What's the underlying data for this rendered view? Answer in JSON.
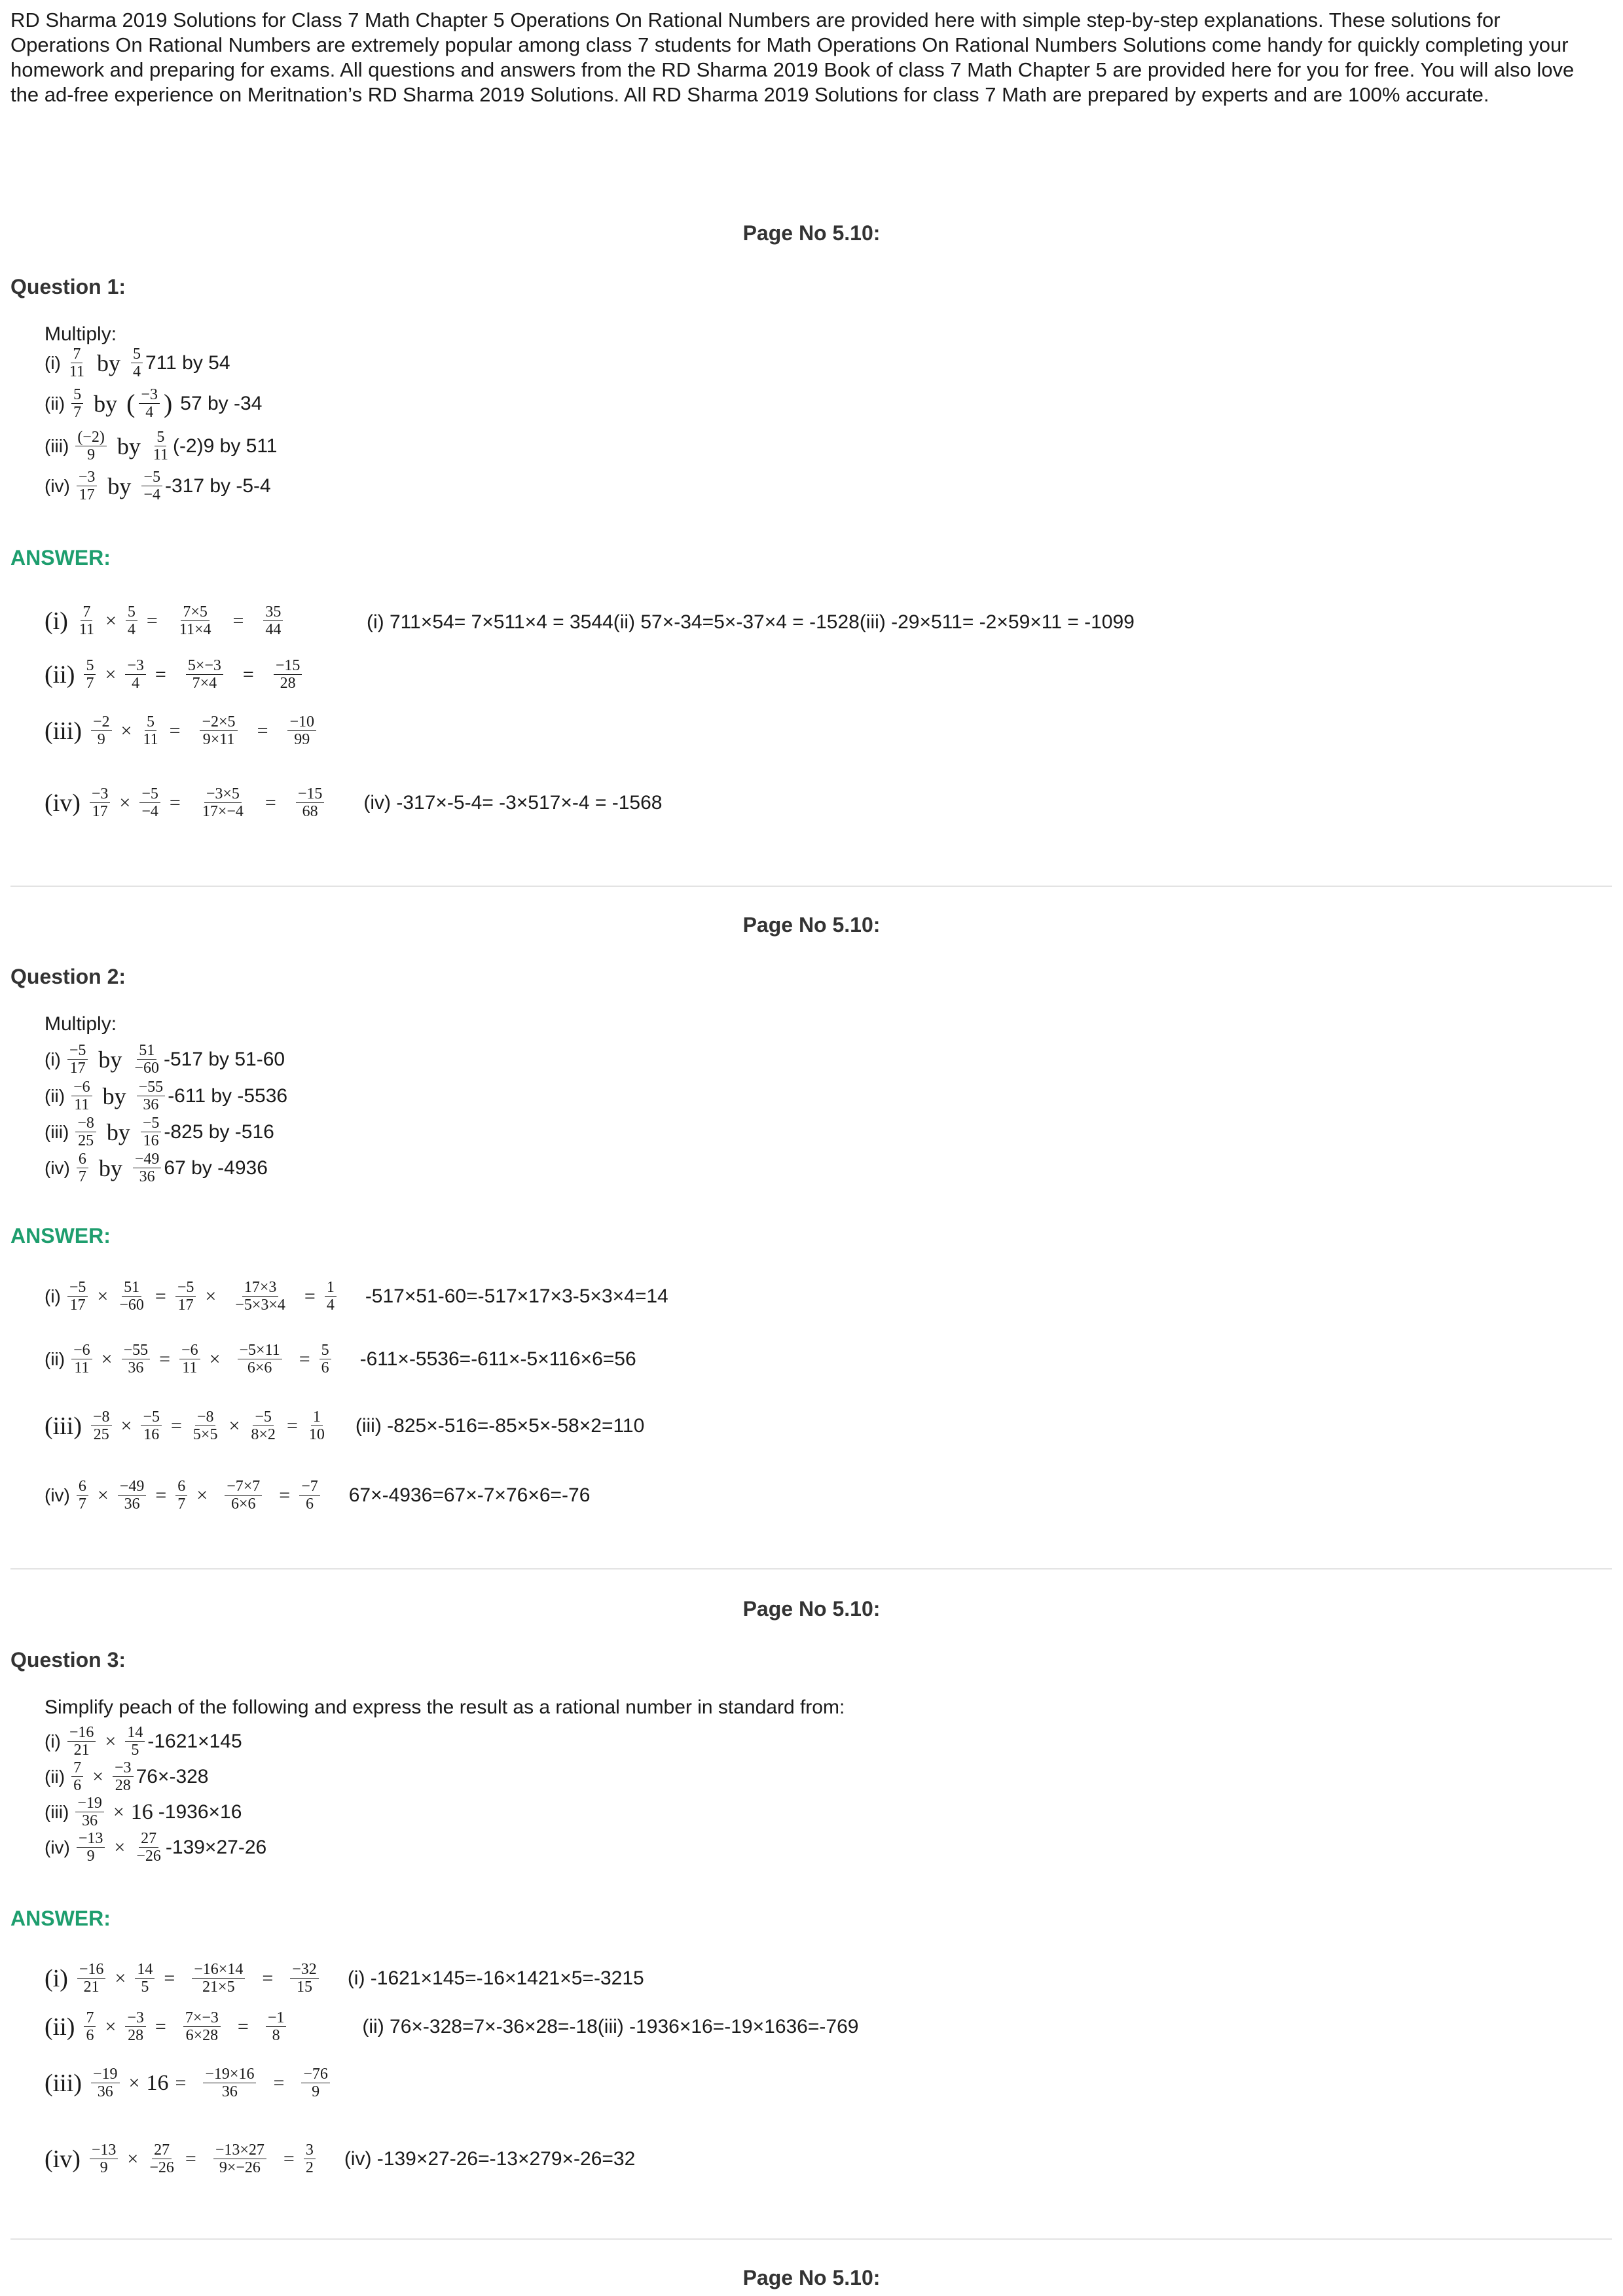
{
  "intro": "RD Sharma 2019 Solutions for Class 7 Math Chapter 5 Operations On Rational Numbers are provided here with simple step-by-step explanations. These solutions for Operations On Rational Numbers are extremely popular among class 7 students for Math Operations On Rational Numbers Solutions come handy for quickly completing your homework and preparing for exams. All questions and answers from the RD Sharma 2019 Book of class 7 Math Chapter 5 are provided here for you for free. You will also love the ad-free experience on Meritnation’s RD Sharma 2019 Solutions. All RD Sharma 2019 Solutions for class 7 Math are prepared by experts and are 100% accurate.",
  "page_no": "Page No 5.10:",
  "answer_label": "ANSWER:",
  "words": {
    "by": "by",
    "times": "×",
    "eq": "=",
    "lp": "(",
    "rp": ")"
  },
  "tags": {
    "i": "(i)",
    "ii": "(ii)",
    "iii": "(iii)",
    "iv": "(iv)"
  },
  "q1": {
    "title": "Question 1:",
    "intro": "Multiply:",
    "items": [
      {
        "a": [
          "7",
          "11"
        ],
        "b": [
          "5",
          "4"
        ],
        "plain": "711 by 54"
      },
      {
        "a": [
          "5",
          "7"
        ],
        "b": [
          "−3",
          "4"
        ],
        "plain": "57 by -34"
      },
      {
        "a": [
          "(−2)",
          "9"
        ],
        "b": [
          "5",
          "11"
        ],
        "plain": "(-2)9 by 511"
      },
      {
        "a": [
          "−3",
          "17"
        ],
        "b": [
          "−5",
          "−4"
        ],
        "plain": "-317 by -5-4"
      }
    ],
    "answer": {
      "rows": [
        {
          "a": [
            "7",
            "11"
          ],
          "b": [
            "5",
            "4"
          ],
          "c": [
            "7×5",
            "11×4"
          ],
          "r": [
            "35",
            "44"
          ]
        },
        {
          "a": [
            "5",
            "7"
          ],
          "b": [
            "−3",
            "4"
          ],
          "c": [
            "5×−3",
            "7×4"
          ],
          "r": [
            "−15",
            "28"
          ]
        },
        {
          "a": [
            "−2",
            "9"
          ],
          "b": [
            "5",
            "11"
          ],
          "c": [
            "−2×5",
            "9×11"
          ],
          "r": [
            "−10",
            "99"
          ]
        },
        {
          "a": [
            "−3",
            "17"
          ],
          "b": [
            "−5",
            "−4"
          ],
          "c": [
            "−3×5",
            "17×−4"
          ],
          "r": [
            "−15",
            "68"
          ]
        }
      ],
      "plain1": "(i) 711×54= 7×511×4 = 3544(ii) 57×-34=5×-37×4 = -1528(iii) -29×511= -2×59×11 = -1099",
      "plain2": "(iv) -317×-5-4= -3×517×-4 = -1568"
    }
  },
  "q2": {
    "title": "Question 2:",
    "intro": "Multiply:",
    "items": [
      {
        "a": [
          "−5",
          "17"
        ],
        "b": [
          "51",
          "−60"
        ],
        "plain": "-517 by 51-60"
      },
      {
        "a": [
          "−6",
          "11"
        ],
        "b": [
          "−55",
          "36"
        ],
        "plain": "-611 by -5536"
      },
      {
        "a": [
          "−8",
          "25"
        ],
        "b": [
          "−5",
          "16"
        ],
        "plain": "-825 by -516"
      },
      {
        "a": [
          "6",
          "7"
        ],
        "b": [
          "−49",
          "36"
        ],
        "plain": "67 by -4936"
      }
    ],
    "answer": {
      "rows": [
        {
          "a": [
            "−5",
            "17"
          ],
          "b": [
            "51",
            "−60"
          ],
          "c": [
            "−5",
            "17"
          ],
          "d": [
            "17×3",
            "−5×3×4"
          ],
          "r": [
            "1",
            "4"
          ],
          "plain": "-517×51-60=-517×17×3-5×3×4=14"
        },
        {
          "a": [
            "−6",
            "11"
          ],
          "b": [
            "−55",
            "36"
          ],
          "c": [
            "−6",
            "11"
          ],
          "d": [
            "−5×11",
            "6×6"
          ],
          "r": [
            "5",
            "6"
          ],
          "plain": "-611×-5536=-611×-5×116×6=56"
        },
        {
          "a": [
            "−8",
            "25"
          ],
          "b": [
            "−5",
            "16"
          ],
          "c": [
            "−8",
            "5×5"
          ],
          "d": [
            "−5",
            "8×2"
          ],
          "r": [
            "1",
            "10"
          ],
          "plain": "(iii) -825×-516=-85×5×-58×2=110"
        },
        {
          "a": [
            "6",
            "7"
          ],
          "b": [
            "−49",
            "36"
          ],
          "c": [
            "6",
            "7"
          ],
          "d": [
            "−7×7",
            "6×6"
          ],
          "r": [
            "−7",
            "6"
          ],
          "plain": "67×-4936=67×-7×76×6=-76"
        }
      ]
    }
  },
  "q3": {
    "title": "Question 3:",
    "intro": "Simplify peach of the following and express the result as a rational number in standard from:",
    "items": [
      {
        "a": [
          "−16",
          "21"
        ],
        "b": [
          "14",
          "5"
        ],
        "plain": "-1621×145"
      },
      {
        "a": [
          "7",
          "6"
        ],
        "b": [
          "−3",
          "28"
        ],
        "plain": "76×-328"
      },
      {
        "a": [
          "−19",
          "36"
        ],
        "b_int": "16",
        "plain": "-1936×16"
      },
      {
        "a": [
          "−13",
          "9"
        ],
        "b": [
          "27",
          "−26"
        ],
        "plain": "-139×27-26"
      }
    ],
    "answer": {
      "rows": [
        {
          "a": [
            "−16",
            "21"
          ],
          "b": [
            "14",
            "5"
          ],
          "c": [
            "−16×14",
            "21×5"
          ],
          "r": [
            "−32",
            "15"
          ],
          "plain": "(i) -1621×145=-16×1421×5=-3215"
        },
        {
          "a": [
            "7",
            "6"
          ],
          "b": [
            "−3",
            "28"
          ],
          "c": [
            "7×−3",
            "6×28"
          ],
          "r": [
            "−1",
            "8"
          ],
          "plain": "(ii) 76×-328=7×-36×28=-18(iii) -1936×16=-19×1636=-769"
        },
        {
          "a": [
            "−19",
            "36"
          ],
          "b_int": "16",
          "c": [
            "−19×16",
            "36"
          ],
          "r": [
            "−76",
            "9"
          ]
        },
        {
          "a": [
            "−13",
            "9"
          ],
          "b": [
            "27",
            "−26"
          ],
          "c": [
            "−13×27",
            "9×−26"
          ],
          "r": [
            "3",
            "2"
          ],
          "plain": "(iv) -139×27-26=-13×279×-26=32"
        }
      ]
    }
  }
}
